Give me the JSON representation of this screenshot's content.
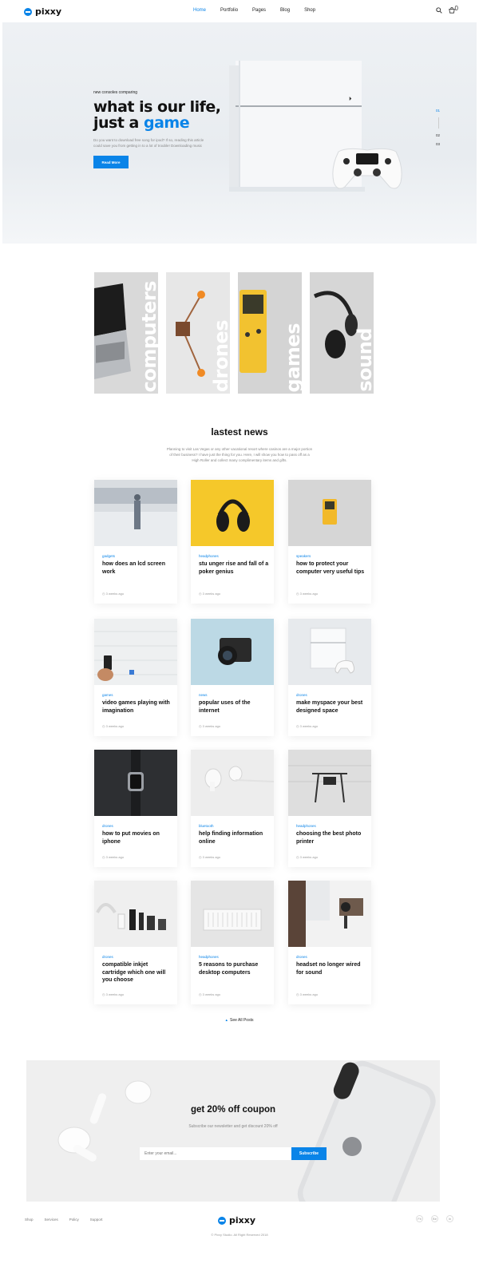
{
  "header": {
    "logo": "pixxy",
    "nav": [
      "Home",
      "Portfolio",
      "Pages",
      "Blog",
      "Shop"
    ],
    "active_nav": "Home",
    "icons": [
      "search-icon",
      "cart-icon"
    ],
    "cart_count": "0"
  },
  "hero": {
    "kicker": "new consoles comparing",
    "title_line1": "what is our life,",
    "title_line2_prefix": "just a",
    "title_line2_accent": "game",
    "description": "Do you want to download free song for ipod? If so, reading this article could save you from getting in to a lot of trouble! Downloading music",
    "button": "Read More",
    "pager": [
      "01",
      "02",
      "03"
    ],
    "accent_color": "#0a84e8"
  },
  "categories": [
    "computers",
    "drones",
    "games",
    "sound"
  ],
  "news": {
    "title": "lastest news",
    "description": "Planning to visit Las Vegas or any other vacational resort where casinos are a major portion of their business? I have just the thing for you. Here, I will show you how to pass off as a High Roller and collect many complimentary items and gifts.",
    "cards": [
      {
        "tag": "gadgets",
        "title": "how does an lcd screen work",
        "time": "3 weeks ago"
      },
      {
        "tag": "headphones",
        "title": "stu unger rise and fall of a poker genius",
        "time": "3 weeks ago"
      },
      {
        "tag": "speakers",
        "title": "how to protect your computer very useful tips",
        "time": "3 weeks ago"
      },
      {
        "tag": "games",
        "title": "video games playing with imagination",
        "time": "3 weeks ago"
      },
      {
        "tag": "news",
        "title": "popular uses of the internet",
        "time": "3 weeks ago"
      },
      {
        "tag": "drones",
        "title": "make myspace your best designed space",
        "time": "3 weeks ago"
      },
      {
        "tag": "drones",
        "title": "how to put movies on iphone",
        "time": "3 weeks ago"
      },
      {
        "tag": "bluetooth",
        "title": "help finding information online",
        "time": "3 weeks ago"
      },
      {
        "tag": "headphones",
        "title": "choosing the best photo printer",
        "time": "3 weeks ago"
      },
      {
        "tag": "drones",
        "title": "compatible inkjet cartridge which one will you choose",
        "time": "3 weeks ago"
      },
      {
        "tag": "headphones",
        "title": "5 reasons to purchase desktop computers",
        "time": "3 weeks ago"
      },
      {
        "tag": "drones",
        "title": "headset no longer wired for sound",
        "time": "3 weeks ago"
      }
    ],
    "see_all": "See All Posts"
  },
  "coupon": {
    "title": "get 20% off coupon",
    "subtitle": "Subscribe our newsletter and get discount 20% off",
    "placeholder": "Enter your email...",
    "button": "Subscribe"
  },
  "footer": {
    "links": [
      "Shop",
      "Services",
      "Policy",
      "Support"
    ],
    "logo": "pixxy",
    "social": [
      "Fb",
      "Be",
      "In"
    ],
    "copyright": "© Pixxy Studio. All Right Reserved 2018"
  }
}
